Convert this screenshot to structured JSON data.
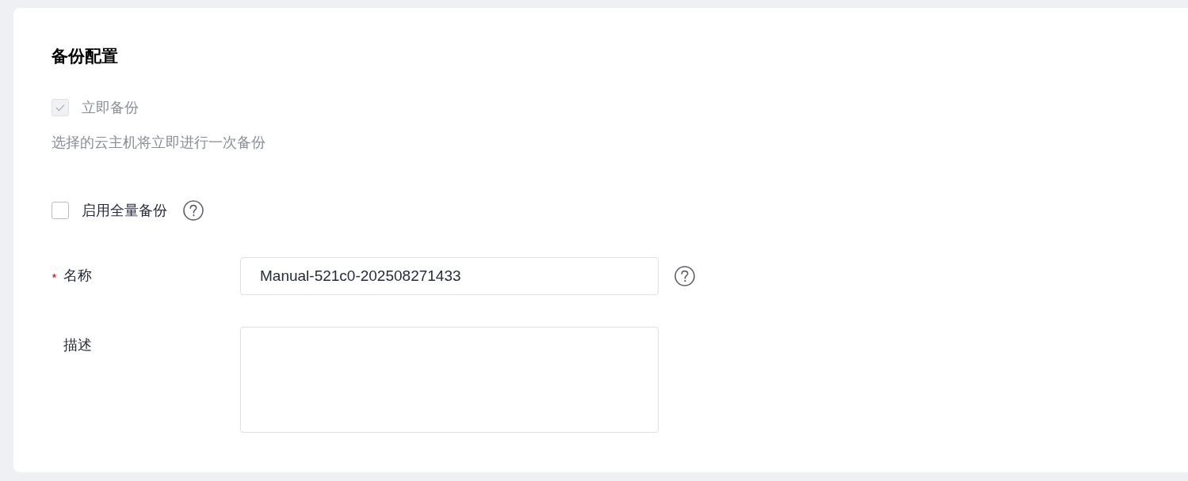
{
  "section": {
    "title": "备份配置"
  },
  "options": [
    {
      "kind": "checkbox",
      "label": "立即备份",
      "checked": true,
      "disabled": true,
      "help": false,
      "hint": "选择的云主机将立即进行一次备份"
    },
    {
      "kind": "checkbox",
      "label": "启用全量备份",
      "checked": false,
      "disabled": false,
      "help": true
    }
  ],
  "fields": [
    {
      "kind": "input",
      "label": "名称",
      "required": true,
      "value": "Manual-521c0-202508271433",
      "help": true
    },
    {
      "kind": "textarea",
      "label": "描述",
      "required": false,
      "help": false
    }
  ]
}
